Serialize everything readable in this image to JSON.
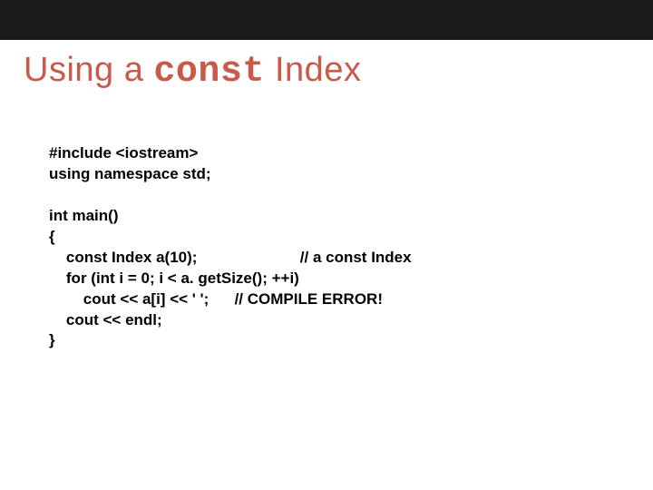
{
  "title": {
    "pre": "Using a ",
    "kw": "const",
    "post": " Index"
  },
  "code": {
    "l1": "#include <iostream>",
    "l2": "using namespace std;",
    "l3": "",
    "l4": "int main()",
    "l5": "{",
    "l6": "    const Index a(10);                        // a const Index",
    "l7": "    for (int i = 0; i < a. getSize(); ++i)",
    "l8": "        cout << a[i] << ' ';      // COMPILE ERROR!",
    "l9": "    cout << endl;",
    "l10": "}"
  }
}
